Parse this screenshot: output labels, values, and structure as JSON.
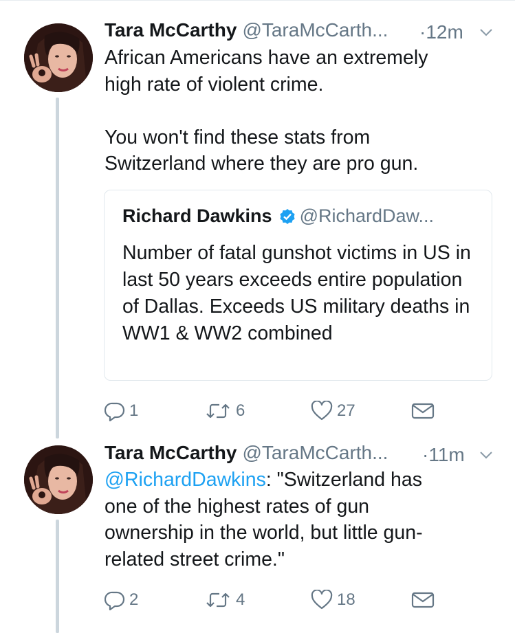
{
  "tweets": [
    {
      "author": "Tara McCarthy",
      "handle": "@TaraMcCarth...",
      "time": "·12m",
      "text": "African Americans have an extremely\nhigh rate of violent crime.\n\nYou won't find these stats from\nSwitzerland where they are pro gun.",
      "quoted": {
        "author": "Richard Dawkins",
        "handle": "@RichardDaw...",
        "text": "Number of fatal gunshot victims in\nUS in last 50 years exceeds entire\npopulation of Dallas. Exceeds US\nmilitary deaths in WW1 & WW2\ncombined"
      },
      "replies": "1",
      "retweets": "6",
      "likes": "27"
    },
    {
      "author": "Tara McCarthy",
      "handle": "@TaraMcCarth...",
      "time": "·11m",
      "mention": "@RichardDawkins",
      "text": ": \"Switzerland has\none of the highest rates of gun\nownership in the world, but little gun-\nrelated street crime.\"",
      "replies": "2",
      "retweets": "4",
      "likes": "18"
    }
  ],
  "icons": {
    "reply": "reply-icon",
    "retweet": "retweet-icon",
    "like": "heart-icon",
    "dm": "envelope-icon",
    "more": "chevron-down-icon",
    "verified": "verified-badge-icon"
  },
  "colors": {
    "text": "#14171a",
    "secondary": "#657786",
    "link": "#1da1f2",
    "thread_line": "#ccd6dd",
    "border": "#e1e8ed"
  }
}
